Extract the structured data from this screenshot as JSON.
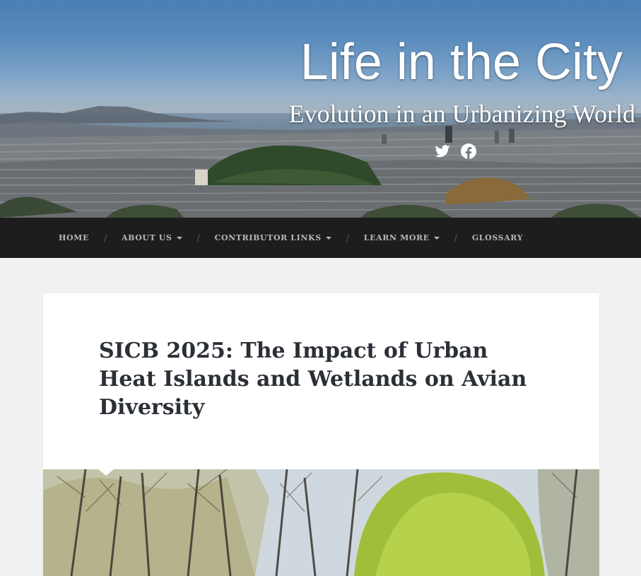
{
  "site": {
    "title": "Life in the City",
    "description": "Evolution in an Urbanizing World"
  },
  "social": {
    "icons": [
      "twitter-icon",
      "facebook-icon"
    ]
  },
  "nav": {
    "items": [
      {
        "label": "HOME",
        "dropdown": false
      },
      {
        "label": "ABOUT US",
        "dropdown": true
      },
      {
        "label": "CONTRIBUTOR LINKS",
        "dropdown": true
      },
      {
        "label": "LEARN MORE",
        "dropdown": true
      },
      {
        "label": "GLOSSARY",
        "dropdown": false
      }
    ],
    "separator": "/"
  },
  "post": {
    "title": "SICB 2025: The Impact of Urban Heat Islands and Wetlands on Avian Diversity"
  },
  "colors": {
    "nav_bg": "#1d1d1d",
    "nav_text": "#b8b8b8",
    "page_bg": "#f1f1f1",
    "title_text": "#2b2f36"
  }
}
